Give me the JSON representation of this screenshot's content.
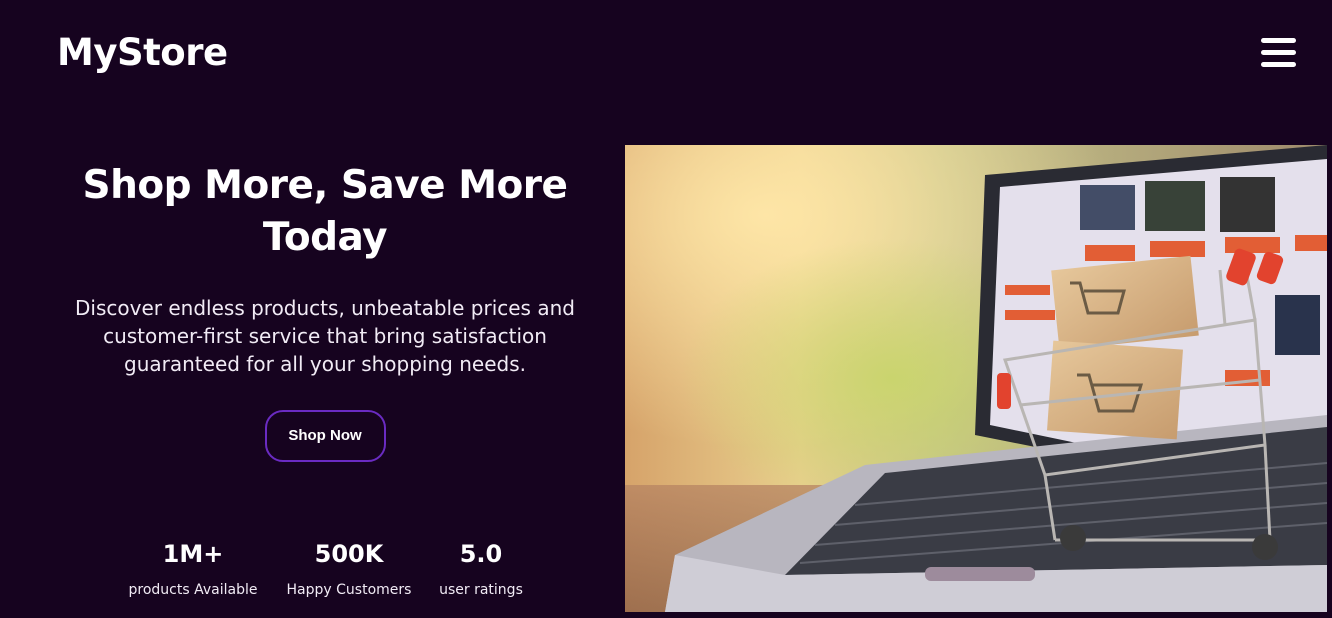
{
  "header": {
    "logo": "MyStore",
    "menu_icon": "hamburger-menu-icon"
  },
  "hero": {
    "title_line1": "Shop More, Save More",
    "title_line2": "Today",
    "description": "Discover endless products, unbeatable prices and customer-first service that bring satisfaction guaranteed for all your shopping needs.",
    "cta_label": "Shop Now",
    "image_semantic": "laptop-with-shopping-cart-photo"
  },
  "stats": [
    {
      "value": "1M+",
      "label": "products Available"
    },
    {
      "value": "500K",
      "label": "Happy Customers"
    },
    {
      "value": "5.0",
      "label": "user ratings"
    }
  ],
  "colors": {
    "background": "#16031f",
    "accent_border": "#6a2bc2",
    "text": "#ffffff"
  }
}
